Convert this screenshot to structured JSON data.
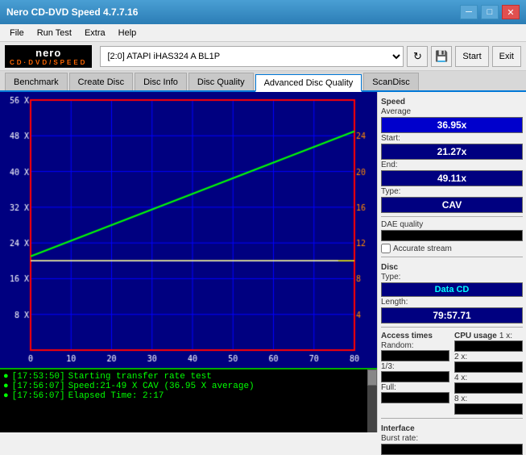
{
  "titleBar": {
    "title": "Nero CD-DVD Speed 4.7.7.16",
    "minimizeBtn": "─",
    "maximizeBtn": "□",
    "closeBtn": "✕"
  },
  "menuBar": {
    "items": [
      "File",
      "Run Test",
      "Extra",
      "Help"
    ]
  },
  "toolbar": {
    "driveLabel": "[2:0]  ATAPI iHAS324  A BL1P",
    "startBtn": "Start",
    "ejectBtn": "Exit"
  },
  "tabs": {
    "items": [
      "Benchmark",
      "Create Disc",
      "Disc Info",
      "Disc Quality",
      "Advanced Disc Quality",
      "ScanDisc"
    ]
  },
  "speed": {
    "sectionTitle": "Speed",
    "averageLabel": "Average",
    "averageValue": "36.95x",
    "startLabel": "Start:",
    "startValue": "21.27x",
    "endLabel": "End:",
    "endValue": "49.11x",
    "typeLabel": "Type:",
    "typeValue": "CAV"
  },
  "accessTimes": {
    "sectionTitle": "Access times",
    "randomLabel": "Random:",
    "randomValue": "",
    "oneThirdLabel": "1/3:",
    "oneThirdValue": "",
    "fullLabel": "Full:",
    "fullValue": ""
  },
  "cpuUsage": {
    "sectionTitle": "CPU usage",
    "oneX": "1 x:",
    "twoX": "2 x:",
    "fourX": "4 x:",
    "eightX": "8 x:"
  },
  "daeQuality": {
    "label": "DAE quality",
    "value": ""
  },
  "accurateStream": {
    "label": "Accurate stream"
  },
  "disc": {
    "sectionTitle": "Disc",
    "typeLabel": "Type:",
    "typeValue": "Data CD",
    "lengthLabel": "Length:",
    "lengthValue": "79:57.71"
  },
  "interface": {
    "sectionTitle": "Interface",
    "burstRateLabel": "Burst rate:",
    "burstRateValue": ""
  },
  "log": {
    "lines": [
      {
        "bullet": "●",
        "time": "[17:53:50]",
        "text": "Starting transfer rate test"
      },
      {
        "bullet": "●",
        "time": "[17:56:07]",
        "text": "Speed:21-49 X CAV (36.95 X average)"
      },
      {
        "bullet": "●",
        "time": "[17:56:07]",
        "text": "Elapsed Time: 2:17"
      }
    ]
  },
  "chart": {
    "yAxisLeft": [
      "56 X",
      "48 X",
      "40 X",
      "32 X",
      "24 X",
      "16 X",
      "8 X"
    ],
    "yAxisRight": [
      "24",
      "20",
      "16",
      "12",
      "8",
      "4"
    ],
    "xAxis": [
      "0",
      "10",
      "20",
      "30",
      "40",
      "50",
      "60",
      "70",
      "80"
    ]
  }
}
